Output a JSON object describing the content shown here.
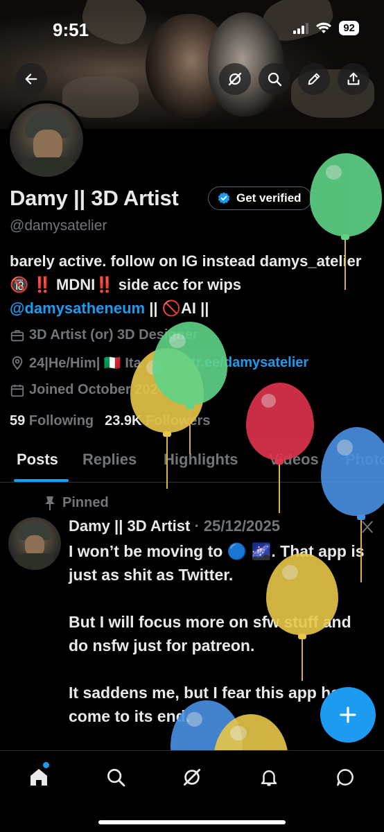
{
  "status_bar": {
    "time": "9:51",
    "battery": "92"
  },
  "header": {
    "back_icon": "arrow-left-icon",
    "actions": [
      "grok-icon",
      "search-icon",
      "edit-icon",
      "share-icon"
    ]
  },
  "profile": {
    "name": "Damy || 3D Artist",
    "verify_label": "Get verified",
    "handle": "@damysatelier",
    "bio_part1": "barely active. follow on IG instead damys_atelier 🔞 ‼️ MDNI‼️  side acc for wips ",
    "bio_mention": "@damysatheneum",
    "bio_part2": " || 🚫AI ||",
    "category": "3D Artist (or) 3D Designer",
    "location": "24|He/Him| 🇮🇹 Ita",
    "website": "linktr.ee/damysatelier",
    "joined": "Joined October 2024",
    "following_count": "59",
    "following_label": "Following",
    "followers_count": "23.9K",
    "followers_label": "Followers"
  },
  "tabs": [
    "Posts",
    "Replies",
    "Highlights",
    "Videos",
    "Photos"
  ],
  "active_tab": "Posts",
  "pinned_post": {
    "pinned_label": "Pinned",
    "author": "Damy || 3D Artist",
    "date": "· 25/12/2025",
    "body": "I won’t be moving to 🔵 🌌. That app is just as shit as Twitter.\n\nBut I will focus more on sfw stuff and do nsfw just for patreon.\n\nIt saddens me, but I fear this app has come to its end.\n\nFollow me on IG or threads. I may"
  },
  "bottom_nav": [
    "home-icon",
    "search-icon",
    "grok-icon",
    "notifications-icon",
    "messages-icon"
  ],
  "colors": {
    "accent": "#1d9bf0",
    "background": "#000000",
    "text_primary": "#e7e9ea",
    "text_secondary": "#71767b",
    "balloon_green": "#5fd488",
    "balloon_yellow": "#e7c649",
    "balloon_red": "#e0344f",
    "balloon_blue": "#4a90e2"
  }
}
